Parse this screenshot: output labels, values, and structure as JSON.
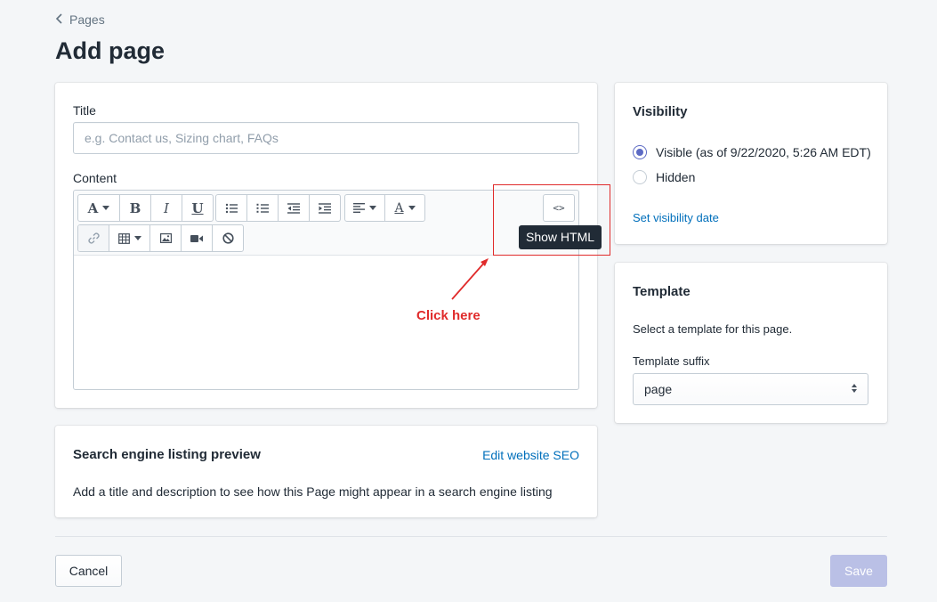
{
  "breadcrumb": {
    "label": "Pages"
  },
  "page": {
    "title": "Add page"
  },
  "main_card": {
    "title_label": "Title",
    "title_placeholder": "e.g. Contact us, Sizing chart, FAQs",
    "content_label": "Content",
    "toolbar": {
      "row1": [
        "font-icon",
        "bold-icon",
        "italic-icon",
        "underline-icon",
        "bullet-list-icon",
        "numbered-list-icon",
        "outdent-icon",
        "indent-icon",
        "align-icon",
        "text-color-icon"
      ],
      "row2": [
        "link-icon",
        "table-icon",
        "image-icon",
        "video-icon",
        "clear-format-icon"
      ],
      "html_button": "<>"
    },
    "tooltip": "Show HTML"
  },
  "annotation": {
    "text": "Click here",
    "color": "#e02b2b"
  },
  "seo_card": {
    "title": "Search engine listing preview",
    "edit_link": "Edit website SEO",
    "description": "Add a title and description to see how this Page might appear in a search engine listing"
  },
  "visibility_card": {
    "title": "Visibility",
    "options": [
      {
        "label": "Visible (as of 9/22/2020, 5:26 AM EDT)",
        "checked": true
      },
      {
        "label": "Hidden",
        "checked": false
      }
    ],
    "set_date_link": "Set visibility date"
  },
  "template_card": {
    "title": "Template",
    "description": "Select a template for this page.",
    "suffix_label": "Template suffix",
    "suffix_value": "page"
  },
  "footer": {
    "cancel_label": "Cancel",
    "save_label": "Save"
  },
  "colors": {
    "accent": "#5c6ac4",
    "link": "#006fbb",
    "save_disabled": "#bac0e6",
    "background": "#f4f6f8"
  }
}
